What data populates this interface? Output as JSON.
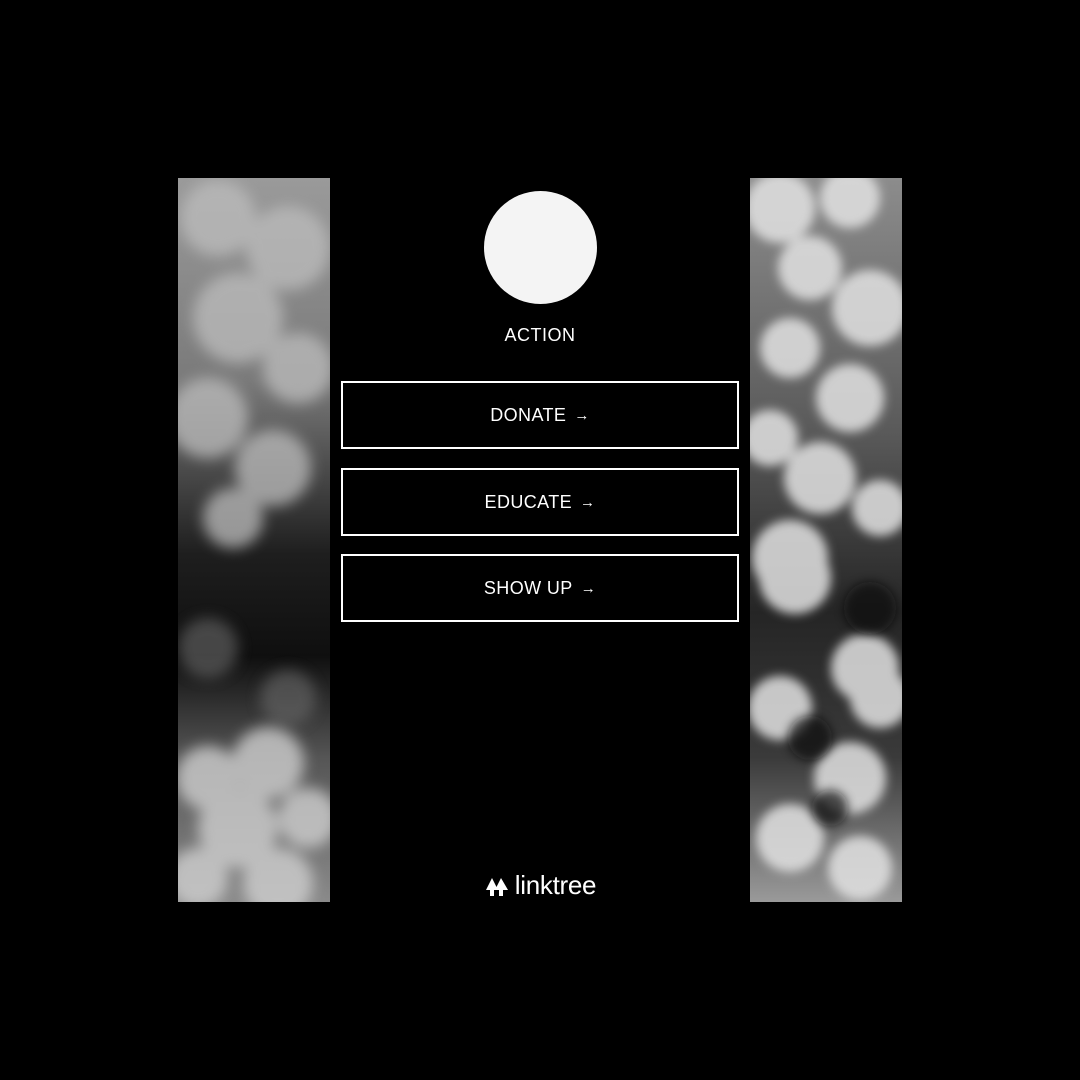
{
  "profile": {
    "name": "ACTION"
  },
  "links": [
    {
      "label": "DONATE",
      "arrow": "→"
    },
    {
      "label": "EDUCATE",
      "arrow": "→"
    },
    {
      "label": "SHOW UP",
      "arrow": "→"
    }
  ],
  "footer": {
    "brand": "linktree",
    "logo_icon": "linktree-logo-icon"
  },
  "colors": {
    "background": "#000000",
    "text": "#ffffff",
    "button_border": "#ffffff",
    "avatar": "#f4f4f4"
  },
  "decor": {
    "left_panel": "clouds-image",
    "right_panel": "clouds-image"
  }
}
